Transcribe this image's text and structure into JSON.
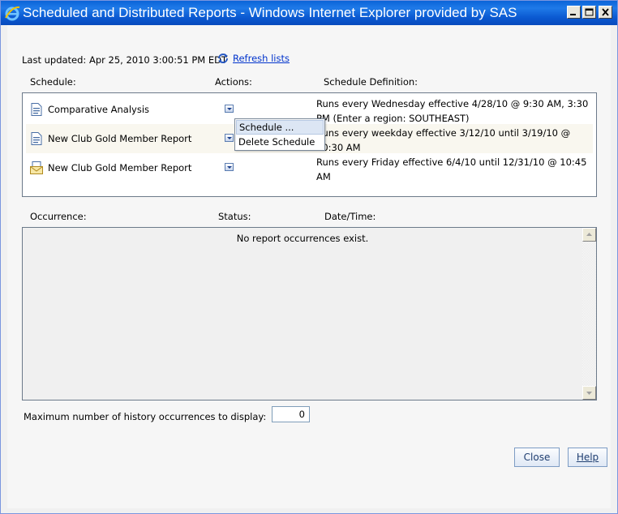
{
  "window": {
    "title": "Scheduled and Distributed Reports - Windows Internet Explorer provided by SAS",
    "controls": [
      "minimize",
      "maximize",
      "close"
    ]
  },
  "header": {
    "last_updated_label": "Last updated:",
    "last_updated_value": "Apr 25, 2010 3:00:51 PM EDT",
    "refresh_label": "Refresh lists"
  },
  "schedule_section": {
    "columns": {
      "schedule": "Schedule:",
      "actions": "Actions:",
      "definition": "Schedule Definition:"
    },
    "rows": [
      {
        "icon": "report-icon",
        "name": "Comparative Analysis",
        "definition": "Runs every Wednesday effective 4/28/10 @ 9:30 AM, 3:30 PM (Enter a region: SOUTHEAST)"
      },
      {
        "icon": "report-icon",
        "name": "New Club Gold Member Report",
        "definition": "Runs every weekday effective 3/12/10 until 3/19/10 @ 10:30 AM"
      },
      {
        "icon": "email-report-icon",
        "name": "New Club Gold Member Report",
        "definition": "Runs every Friday effective 6/4/10 until 12/31/10 @ 10:45 AM"
      }
    ],
    "context_menu": {
      "items": [
        "Schedule ...",
        "Delete Schedule"
      ],
      "highlighted_index": 0
    }
  },
  "occurrence_section": {
    "columns": {
      "occurrence": "Occurrence:",
      "status": "Status:",
      "datetime": "Date/Time:"
    },
    "empty_message": "No report occurrences exist."
  },
  "history": {
    "label": "Maximum number of history occurrences to display:",
    "value": "0"
  },
  "buttons": {
    "close": "Close",
    "help": "Help"
  }
}
